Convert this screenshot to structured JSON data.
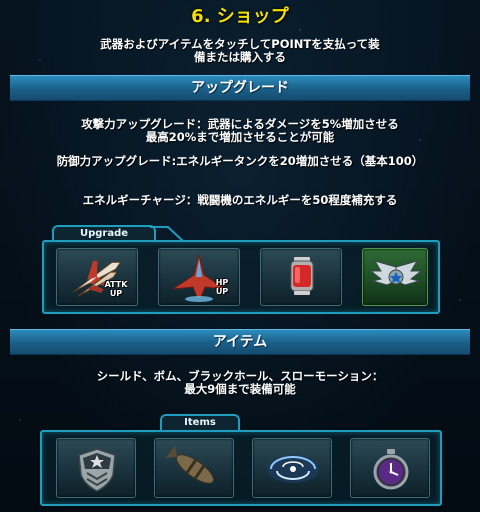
{
  "title": "6. ショップ",
  "intro": {
    "line1": "武器およびアイテムをタッチしてPOINTを支払って装",
    "line2": "備または購入する"
  },
  "upgrade_section": {
    "banner": "アップグレード",
    "attack_line1": "攻撃力アップグレード：武器によるダメージを5%増加させる",
    "attack_line2": "最高20%まで増加させることが可能",
    "defense_line": "防御力アップグレード:エネルギータンクを20増加させる（基本100）",
    "charge_line": "エネルギーチャージ：戦闘機のエネルギーを50程度補充する",
    "tab_label": "Upgrade",
    "slots": [
      {
        "icon": "attack-upgrade-icon",
        "label_top": "ATTK",
        "label_bottom": "UP"
      },
      {
        "icon": "hp-upgrade-icon",
        "label_top": "HP",
        "label_bottom": "UP"
      },
      {
        "icon": "energy-tank-icon"
      },
      {
        "icon": "wing-emblem-icon",
        "highlighted": true
      }
    ]
  },
  "items_section": {
    "banner": "アイテム",
    "line1": "シールド、ボム、ブラックホール、スローモーション：",
    "line2": "最大9個まで装備可能",
    "tab_label": "Items",
    "slots": [
      {
        "icon": "shield-icon"
      },
      {
        "icon": "bomb-icon"
      },
      {
        "icon": "black-hole-icon"
      },
      {
        "icon": "slow-motion-stopwatch-icon"
      }
    ]
  },
  "colors": {
    "title": "#f4e000",
    "banner": "#2c8bbd",
    "panel_border": "#1e9dbf",
    "highlight_slot": "#2f6a36"
  }
}
